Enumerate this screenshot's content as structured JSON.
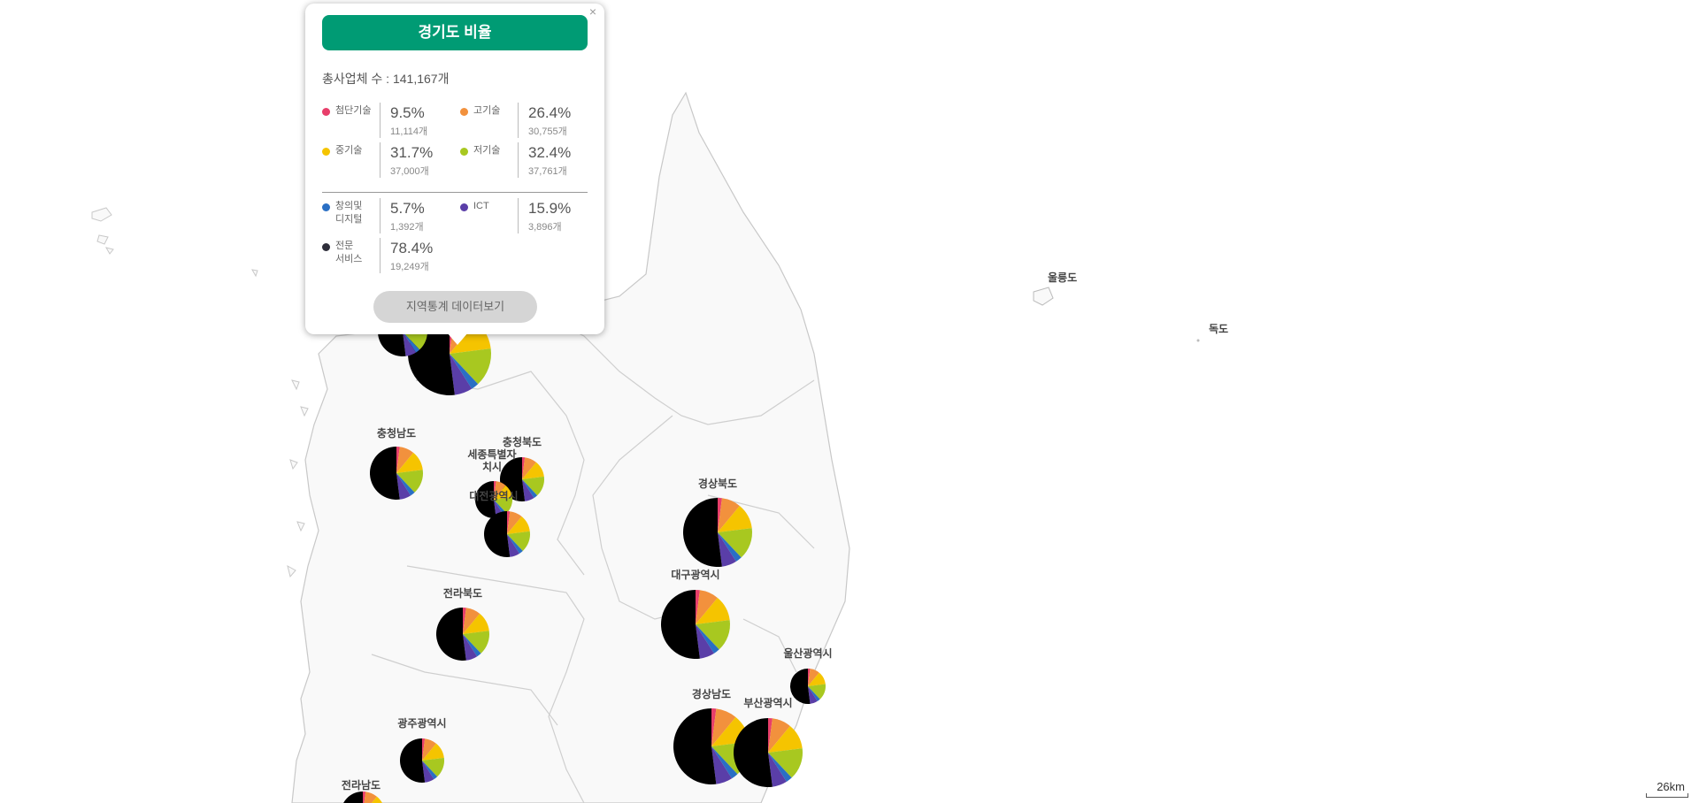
{
  "popup": {
    "title": "경기도 비율",
    "close_label": "×",
    "total": "총사업체 수 : 141,167개",
    "items_a": [
      {
        "name": "첨단기술",
        "pct": "9.5%",
        "count": "11,114개",
        "color": "#e83e6a"
      },
      {
        "name": "고기술",
        "pct": "26.4%",
        "count": "30,755개",
        "color": "#f2913d"
      },
      {
        "name": "중기술",
        "pct": "31.7%",
        "count": "37,000개",
        "color": "#f5c400"
      },
      {
        "name": "저기술",
        "pct": "32.4%",
        "count": "37,761개",
        "color": "#a8c820"
      }
    ],
    "items_b": [
      {
        "name": "창의및\n디지털",
        "pct": "5.7%",
        "count": "1,392개",
        "color": "#2a6fc4"
      },
      {
        "name": "ICT",
        "pct": "15.9%",
        "count": "3,896개",
        "color": "#5a3ea8"
      },
      {
        "name": "전문\n서비스",
        "pct": "78.4%",
        "count": "19,249개",
        "color": "#2e2e3a"
      }
    ],
    "data_button": "지역통계 데이터보기"
  },
  "islands": {
    "ulleungdo": "울릉도",
    "dokdo": "독도"
  },
  "regions": [
    {
      "name": "충청남도",
      "scale": 1.0
    },
    {
      "name": "충청북도",
      "scale": 1.0
    },
    {
      "name": "세종특별자\n치시",
      "scale": 1.0
    },
    {
      "name": "대전광역시",
      "scale": 1.0
    },
    {
      "name": "경상북도",
      "scale": 1.0
    },
    {
      "name": "대구광역시",
      "scale": 1.0
    },
    {
      "name": "전라북도",
      "scale": 1.0
    },
    {
      "name": "울산광역시",
      "scale": 1.0
    },
    {
      "name": "경상남도",
      "scale": 1.0
    },
    {
      "name": "부산광역시",
      "scale": 1.0
    },
    {
      "name": "광주광역시",
      "scale": 1.0
    },
    {
      "name": "전라남도",
      "scale": 1.0
    }
  ],
  "pie_colors": {
    "black": "#000000",
    "pink": "#e83e6a",
    "orange": "#f2913d",
    "yellow": "#f5c400",
    "green": "#a8c820",
    "blue": "#2a6fc4",
    "purple": "#5a3ea8"
  },
  "scale_label": "26km"
}
